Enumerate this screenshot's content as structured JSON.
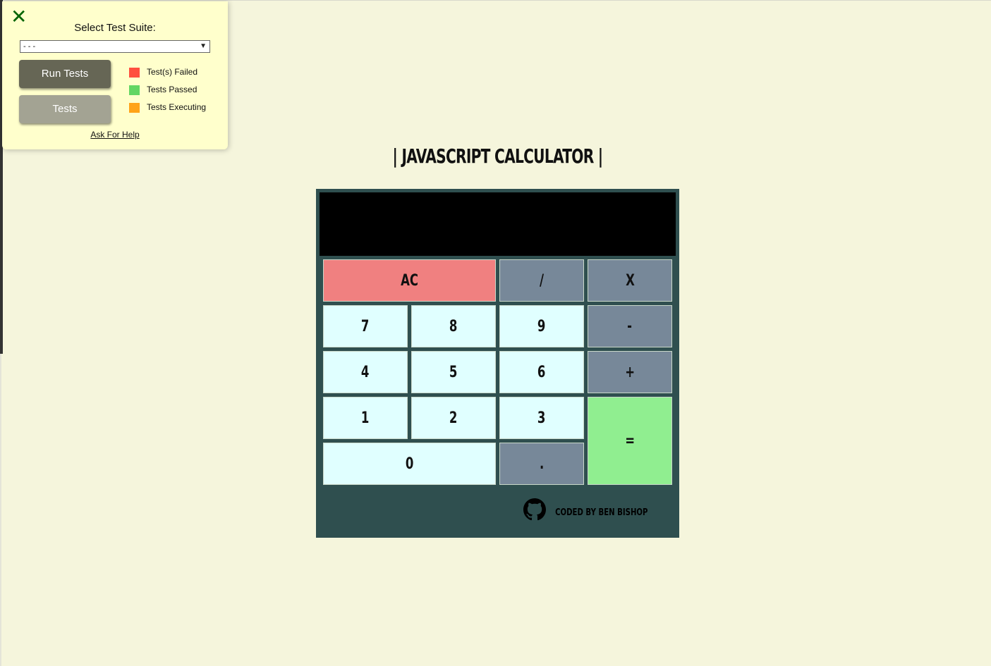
{
  "test_panel": {
    "close_icon": "close-x-icon",
    "select_label": "Select Test Suite:",
    "select_value": "- - -",
    "run_button": "Run Tests",
    "tests_button": "Tests",
    "legend": [
      {
        "label": "Test(s) Failed",
        "color": "#FF4F3F"
      },
      {
        "label": "Tests Passed",
        "color": "#63D663"
      },
      {
        "label": "Tests Executing",
        "color": "#FFA318"
      }
    ],
    "help_link": "Ask For Help"
  },
  "calculator": {
    "title": "| JAVASCRIPT CALCULATOR |",
    "display_value": "",
    "keys": {
      "clear": "AC",
      "divide": "/",
      "multiply": "X",
      "seven": "7",
      "eight": "8",
      "nine": "9",
      "subtract": "-",
      "four": "4",
      "five": "5",
      "six": "6",
      "add": "+",
      "one": "1",
      "two": "2",
      "three": "3",
      "equals": "=",
      "zero": "0",
      "decimal": "."
    },
    "footer": "CODED BY BEN BISHOP",
    "footer_icon": "github-icon"
  },
  "colors": {
    "background": "#F5F5DC",
    "calculator_body": "#2F4F4F",
    "clear_key": "#F08080",
    "operator_key": "#778899",
    "number_key": "#E0FFFF",
    "equals_key": "#90EE90",
    "panel": "#FFFFCC"
  }
}
